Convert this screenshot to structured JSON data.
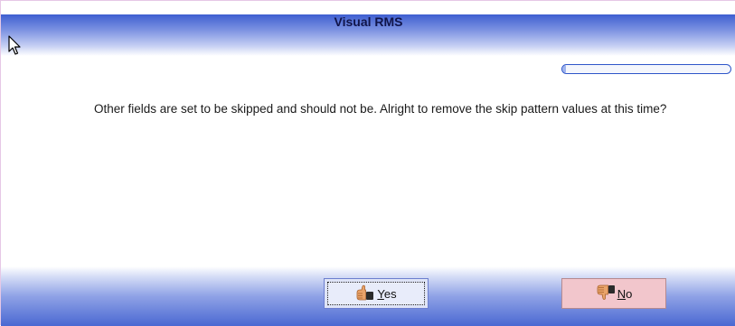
{
  "window": {
    "title": "Visual RMS"
  },
  "progress": {
    "fraction": 0.02
  },
  "message": {
    "text": "Other fields are set to be skipped and should not be. Alright to remove the skip pattern values at this time?"
  },
  "buttons": {
    "yes": {
      "accel": "Y",
      "rest": "es",
      "icon": "thumbs-up-icon"
    },
    "no": {
      "accel": "N",
      "rest": "o",
      "icon": "thumbs-down-icon"
    }
  },
  "colors": {
    "title_gradient_top": "#3e5fd0",
    "yes_button_bg": "#dfe4f7",
    "no_button_bg": "#f2c6cc",
    "progress_border": "#2e56c9"
  }
}
